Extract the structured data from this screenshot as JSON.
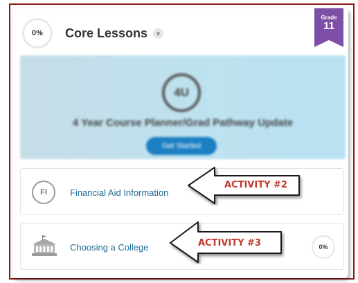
{
  "header": {
    "progress": "0%",
    "title": "Core Lessons",
    "chevron_icon": "chevron-down-icon"
  },
  "grade": {
    "label": "Grade",
    "value": "11",
    "color": "#7d4fa6"
  },
  "banner": {
    "badge": "4U",
    "title": "4 Year Course Planner/Grad Pathway Update",
    "cta_label": "Get Started",
    "cta_color": "#1c7fc2"
  },
  "lessons": [
    {
      "icon_text": "FI",
      "title": "Financial Aid Information",
      "callout": "ACTIVITY #2"
    },
    {
      "icon": "college-building-icon",
      "title": "Choosing a College",
      "progress": "0%",
      "callout": "ACTIVITY #3"
    }
  ],
  "colors": {
    "link": "#1f6b95",
    "callout_text": "#c0392b",
    "frame_border": "#8b1a1a"
  }
}
